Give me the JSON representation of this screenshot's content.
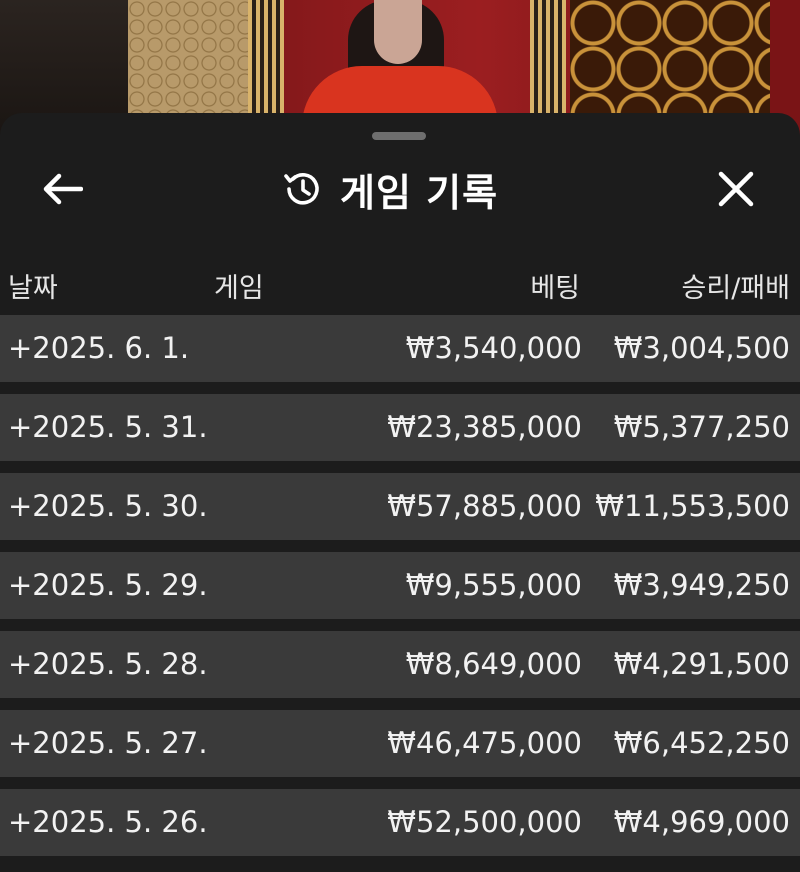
{
  "header": {
    "title": "게임 기록",
    "back_icon": "arrow-left-icon",
    "history_icon": "history-clock-icon",
    "close_icon": "close-icon"
  },
  "columns": {
    "date": "날짜",
    "game": "게임",
    "bet": "베팅",
    "win_loss": "승리/패배"
  },
  "rows": [
    {
      "date": "+2025. 6. 1.",
      "game": "",
      "bet": "₩3,540,000",
      "win_loss": "₩3,004,500"
    },
    {
      "date": "+2025. 5. 31.",
      "game": "",
      "bet": "₩23,385,000",
      "win_loss": "₩5,377,250"
    },
    {
      "date": "+2025. 5. 30.",
      "game": "",
      "bet": "₩57,885,000",
      "win_loss": "₩11,553,500"
    },
    {
      "date": "+2025. 5. 29.",
      "game": "",
      "bet": "₩9,555,000",
      "win_loss": "₩3,949,250"
    },
    {
      "date": "+2025. 5. 28.",
      "game": "",
      "bet": "₩8,649,000",
      "win_loss": "₩4,291,500"
    },
    {
      "date": "+2025. 5. 27.",
      "game": "",
      "bet": "₩46,475,000",
      "win_loss": "₩6,452,250"
    },
    {
      "date": "+2025. 5. 26.",
      "game": "",
      "bet": "₩52,500,000",
      "win_loss": "₩4,969,000"
    }
  ],
  "colors": {
    "panel_bg": "#1c1c1c",
    "row_bg": "#3a3a3a",
    "text": "#ffffff"
  }
}
